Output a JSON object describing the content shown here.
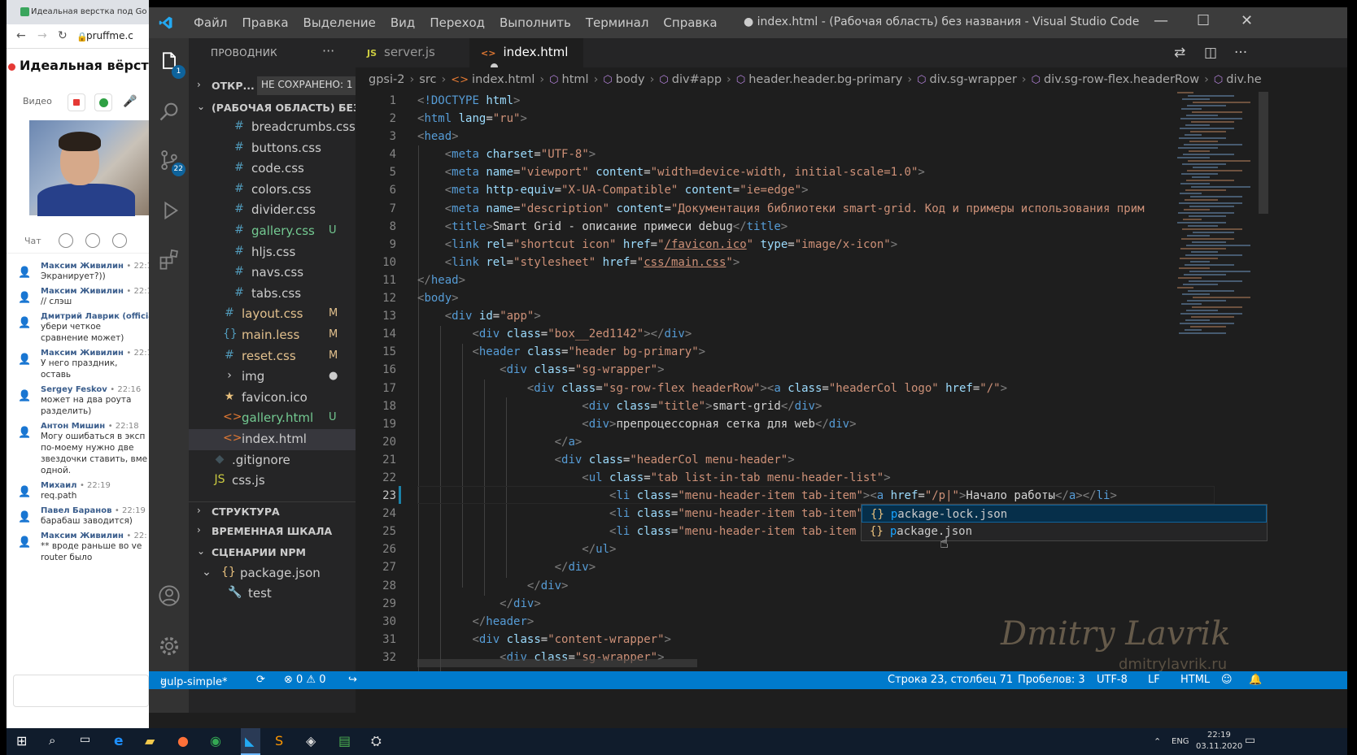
{
  "browser": {
    "tab_title": "Идеальная верстка под Go",
    "url": "pruffme.c",
    "heading": "Идеальная вёрстка",
    "video_label": "Видео",
    "chat_label": "Чат"
  },
  "chat": [
    {
      "name": "Максим Живилин",
      "time": "• 22:1",
      "text": "Экранирует?))"
    },
    {
      "name": "Максим Живилин",
      "time": "• 22:1",
      "text": "// слэш"
    },
    {
      "name": "Дмитрий Лаврик (official)",
      "time": "",
      "text": "убери четкое сравнение может)"
    },
    {
      "name": "Максим Живилин",
      "time": "• 22:1",
      "text": "У него праздник, оставь"
    },
    {
      "name": "Sergey Feskov",
      "time": "• 22:16",
      "text": "может на два роута разделить)"
    },
    {
      "name": "Антон Мишин",
      "time": "• 22:18",
      "text": "Могу ошибаться в эксп по-моему нужно две звездочки ставить, вме одной."
    },
    {
      "name": "Михаил",
      "time": "• 22:19",
      "text": "req.path"
    },
    {
      "name": "Павел Баранов",
      "time": "• 22:19",
      "text": "барабаш заводится)"
    },
    {
      "name": "Максим Живилин",
      "time": "• 22:",
      "text": "** вроде раньше во ve router было"
    }
  ],
  "vscode": {
    "menu": [
      "Файл",
      "Правка",
      "Выделение",
      "Вид",
      "Переход",
      "Выполнить",
      "Терминал",
      "Справка"
    ],
    "window_title": "● index.html - (Рабочая область) без названия - Visual Studio Code",
    "activity_badges": {
      "explorer": "1",
      "scm": "22"
    },
    "explorer_title": "ПРОВОДНИК",
    "open_editors": "ОТКР...",
    "unsaved_badge": "НЕ СОХРАНЕНО: 1",
    "workspace": "(РАБОЧАЯ ОБЛАСТЬ) БЕЗ ...",
    "files": [
      {
        "icon": "#",
        "name": "breadcrumbs.css",
        "status": "",
        "color": "#ccc",
        "icolor": "#519aba",
        "indent": 2
      },
      {
        "icon": "#",
        "name": "buttons.css",
        "status": "",
        "color": "#ccc",
        "icolor": "#519aba",
        "indent": 2
      },
      {
        "icon": "#",
        "name": "code.css",
        "status": "",
        "color": "#ccc",
        "icolor": "#519aba",
        "indent": 2
      },
      {
        "icon": "#",
        "name": "colors.css",
        "status": "",
        "color": "#ccc",
        "icolor": "#519aba",
        "indent": 2
      },
      {
        "icon": "#",
        "name": "divider.css",
        "status": "",
        "color": "#ccc",
        "icolor": "#519aba",
        "indent": 2
      },
      {
        "icon": "#",
        "name": "gallery.css",
        "status": "U",
        "color": "#73c991",
        "icolor": "#519aba",
        "indent": 2
      },
      {
        "icon": "#",
        "name": "hljs.css",
        "status": "",
        "color": "#ccc",
        "icolor": "#519aba",
        "indent": 2
      },
      {
        "icon": "#",
        "name": "navs.css",
        "status": "",
        "color": "#ccc",
        "icolor": "#519aba",
        "indent": 2
      },
      {
        "icon": "#",
        "name": "tabs.css",
        "status": "",
        "color": "#ccc",
        "icolor": "#519aba",
        "indent": 2
      },
      {
        "icon": "#",
        "name": "layout.css",
        "status": "M",
        "color": "#e2c08d",
        "icolor": "#519aba",
        "indent": 1
      },
      {
        "icon": "{}",
        "name": "main.less",
        "status": "M",
        "color": "#e2c08d",
        "icolor": "#519aba",
        "indent": 1
      },
      {
        "icon": "#",
        "name": "reset.css",
        "status": "M",
        "color": "#e2c08d",
        "icolor": "#519aba",
        "indent": 1
      },
      {
        "icon": "›",
        "name": "img",
        "status": "●",
        "color": "#ccc",
        "icolor": "#ccc",
        "indent": 1
      },
      {
        "icon": "★",
        "name": "favicon.ico",
        "status": "",
        "color": "#ccc",
        "icolor": "#e8c07d",
        "indent": 1
      },
      {
        "icon": "<>",
        "name": "gallery.html",
        "status": "U",
        "color": "#73c991",
        "icolor": "#e37933",
        "indent": 1
      },
      {
        "icon": "<>",
        "name": "index.html",
        "status": "",
        "color": "#ccc",
        "icolor": "#e37933",
        "indent": 1
      },
      {
        "icon": "◆",
        "name": ".gitignore",
        "status": "",
        "color": "#ccc",
        "icolor": "#41535b",
        "indent": 0
      },
      {
        "icon": "JS",
        "name": "css.js",
        "status": "",
        "color": "#ccc",
        "icolor": "#cbcb41",
        "indent": 0
      }
    ],
    "sections": {
      "structure": "СТРУКТУРА",
      "timeline": "ВРЕМЕННАЯ ШКАЛА",
      "npm": "СЦЕНАРИИ NPM",
      "package": "package.json",
      "test": "test"
    },
    "tabs": [
      {
        "icon": "JS",
        "label": "server.js"
      },
      {
        "icon": "<>",
        "label": "index.html"
      }
    ],
    "breadcrumbs": [
      "gpsi-2",
      "src",
      "index.html",
      "html",
      "body",
      "div#app",
      "header.header.bg-primary",
      "div.sg-wrapper",
      "div.sg-row-flex.headerRow",
      "div.he"
    ],
    "code": [
      "<span class=\"p\">&lt;</span><span class=\"t\">!DOCTYPE</span> <span class=\"a\">html</span><span class=\"p\">&gt;</span>",
      "<span class=\"p\">&lt;</span><span class=\"t\">html</span> <span class=\"a\">lang</span>=<span class=\"s\">\"ru\"</span><span class=\"p\">&gt;</span>",
      "<span class=\"p\">&lt;</span><span class=\"t\">head</span><span class=\"p\">&gt;</span>",
      "  <span class=\"p\">&lt;</span><span class=\"t\">meta</span> <span class=\"a\">charset</span>=<span class=\"s\">\"UTF-8\"</span><span class=\"p\">&gt;</span>",
      "  <span class=\"p\">&lt;</span><span class=\"t\">meta</span> <span class=\"a\">name</span>=<span class=\"s\">\"viewport\"</span> <span class=\"a\">content</span>=<span class=\"s\">\"width=device-width, initial-scale=1.0\"</span><span class=\"p\">&gt;</span>",
      "  <span class=\"p\">&lt;</span><span class=\"t\">meta</span> <span class=\"a\">http-equiv</span>=<span class=\"s\">\"X-UA-Compatible\"</span> <span class=\"a\">content</span>=<span class=\"s\">\"ie=edge\"</span><span class=\"p\">&gt;</span>",
      "  <span class=\"p\">&lt;</span><span class=\"t\">meta</span> <span class=\"a\">name</span>=<span class=\"s\">\"description\"</span> <span class=\"a\">content</span>=<span class=\"s\">\"Документация библиотеки smart-grid. Код и примеры использования прим</span>",
      "  <span class=\"p\">&lt;</span><span class=\"t\">title</span><span class=\"p\">&gt;</span>Smart Grid - описание примеси debug<span class=\"p\">&lt;/</span><span class=\"t\">title</span><span class=\"p\">&gt;</span>",
      "  <span class=\"p\">&lt;</span><span class=\"t\">link</span> <span class=\"a\">rel</span>=<span class=\"s\">\"shortcut icon\"</span> <span class=\"a\">href</span>=<span class=\"s\">\"<span class=\"u\">/favicon.ico</span>\"</span> <span class=\"a\">type</span>=<span class=\"s\">\"image/x-icon\"</span><span class=\"p\">&gt;</span>",
      "  <span class=\"p\">&lt;</span><span class=\"t\">link</span> <span class=\"a\">rel</span>=<span class=\"s\">\"stylesheet\"</span> <span class=\"a\">href</span>=<span class=\"s\">\"<span class=\"u\">css/main.css</span>\"</span><span class=\"p\">&gt;</span>",
      "<span class=\"p\">&lt;/</span><span class=\"t\">head</span><span class=\"p\">&gt;</span>",
      "<span class=\"p\">&lt;</span><span class=\"t\">body</span><span class=\"p\">&gt;</span>",
      "  <span class=\"p\">&lt;</span><span class=\"t\">div</span> <span class=\"a\">id</span>=<span class=\"s\">\"app\"</span><span class=\"p\">&gt;</span>",
      "    <span class=\"p\">&lt;</span><span class=\"t\">div</span> <span class=\"a\">class</span>=<span class=\"s\">\"box__2ed1142\"</span><span class=\"p\">&gt;&lt;/</span><span class=\"t\">div</span><span class=\"p\">&gt;</span>",
      "    <span class=\"p\">&lt;</span><span class=\"t\">header</span> <span class=\"a\">class</span>=<span class=\"s\">\"header bg-primary\"</span><span class=\"p\">&gt;</span>",
      "      <span class=\"p\">&lt;</span><span class=\"t\">div</span> <span class=\"a\">class</span>=<span class=\"s\">\"sg-wrapper\"</span><span class=\"p\">&gt;</span>",
      "        <span class=\"p\">&lt;</span><span class=\"t\">div</span> <span class=\"a\">class</span>=<span class=\"s\">\"sg-row-flex headerRow\"</span><span class=\"p\">&gt;&lt;</span><span class=\"t\">a</span> <span class=\"a\">class</span>=<span class=\"s\">\"headerCol logo\"</span> <span class=\"a\">href</span>=<span class=\"s\">\"/\"</span><span class=\"p\">&gt;</span>",
      "            <span class=\"p\">&lt;</span><span class=\"t\">div</span> <span class=\"a\">class</span>=<span class=\"s\">\"title\"</span><span class=\"p\">&gt;</span>smart-grid<span class=\"p\">&lt;/</span><span class=\"t\">div</span><span class=\"p\">&gt;</span>",
      "            <span class=\"p\">&lt;</span><span class=\"t\">div</span><span class=\"p\">&gt;</span>препроцессорная сетка для web<span class=\"p\">&lt;/</span><span class=\"t\">div</span><span class=\"p\">&gt;</span>",
      "          <span class=\"p\">&lt;/</span><span class=\"t\">a</span><span class=\"p\">&gt;</span>",
      "          <span class=\"p\">&lt;</span><span class=\"t\">div</span> <span class=\"a\">class</span>=<span class=\"s\">\"headerCol menu-header\"</span><span class=\"p\">&gt;</span>",
      "            <span class=\"p\">&lt;</span><span class=\"t\">ul</span> <span class=\"a\">class</span>=<span class=\"s\">\"tab list-in-tab menu-header-list\"</span><span class=\"p\">&gt;</span>",
      "              <span class=\"p\">&lt;</span><span class=\"t\">li</span> <span class=\"a\">class</span>=<span class=\"s\">\"menu-header-item tab-item\"</span><span class=\"p\">&gt;&lt;</span><span class=\"t\">a</span> <span class=\"a\">href</span>=<span class=\"s\">\"/p|\"</span><span class=\"p\">&gt;</span>Начало работы<span class=\"p\">&lt;/</span><span class=\"t\">a</span><span class=\"p\">&gt;&lt;/</span><span class=\"t\">li</span><span class=\"p\">&gt;</span>",
      "              <span class=\"p\">&lt;</span><span class=\"t\">li</span> <span class=\"a\">class</span>=<span class=\"s\">\"menu-header-item tab-item\"</span><span class=\"p\">&gt;&lt;</span><span class=\"t\">a</span>",
      "              <span class=\"p\">&lt;</span><span class=\"t\">li</span> <span class=\"a\">class</span>=<span class=\"s\">\"menu-header-item tab-item act</span>",
      "            <span class=\"p\">&lt;/</span><span class=\"t\">ul</span><span class=\"p\">&gt;</span>",
      "          <span class=\"p\">&lt;/</span><span class=\"t\">div</span><span class=\"p\">&gt;</span>",
      "        <span class=\"p\">&lt;/</span><span class=\"t\">div</span><span class=\"p\">&gt;</span>",
      "      <span class=\"p\">&lt;/</span><span class=\"t\">div</span><span class=\"p\">&gt;</span>",
      "    <span class=\"p\">&lt;/</span><span class=\"t\">header</span><span class=\"p\">&gt;</span>",
      "    <span class=\"p\">&lt;</span><span class=\"t\">div</span> <span class=\"a\">class</span>=<span class=\"s\">\"content-wrapper\"</span><span class=\"p\">&gt;</span>",
      "      <span class=\"p\">&lt;</span><span class=\"t\">div</span> <span class=\"a\">class</span>=<span class=\"s\">\"sg-wrapper\"</span><span class=\"p\">&gt;</span>"
    ],
    "suggestions": [
      {
        "match": "p",
        "rest": "ackage-lock.json"
      },
      {
        "match": "p",
        "rest": "ackage.json"
      }
    ],
    "status": {
      "branch": "gulp-simple*",
      "problems": "⊗ 0 ⚠ 0",
      "position": "Строка 23, столбец 71",
      "spaces": "Пробелов: 3",
      "encoding": "UTF-8",
      "eol": "LF",
      "language": "HTML"
    },
    "watermark": "Dmitry Lavrik",
    "watermark_url": "dmitrylavrik.ru"
  },
  "taskbar": {
    "lang": "ENG",
    "time": "22:19",
    "date": "03.11.2020"
  }
}
